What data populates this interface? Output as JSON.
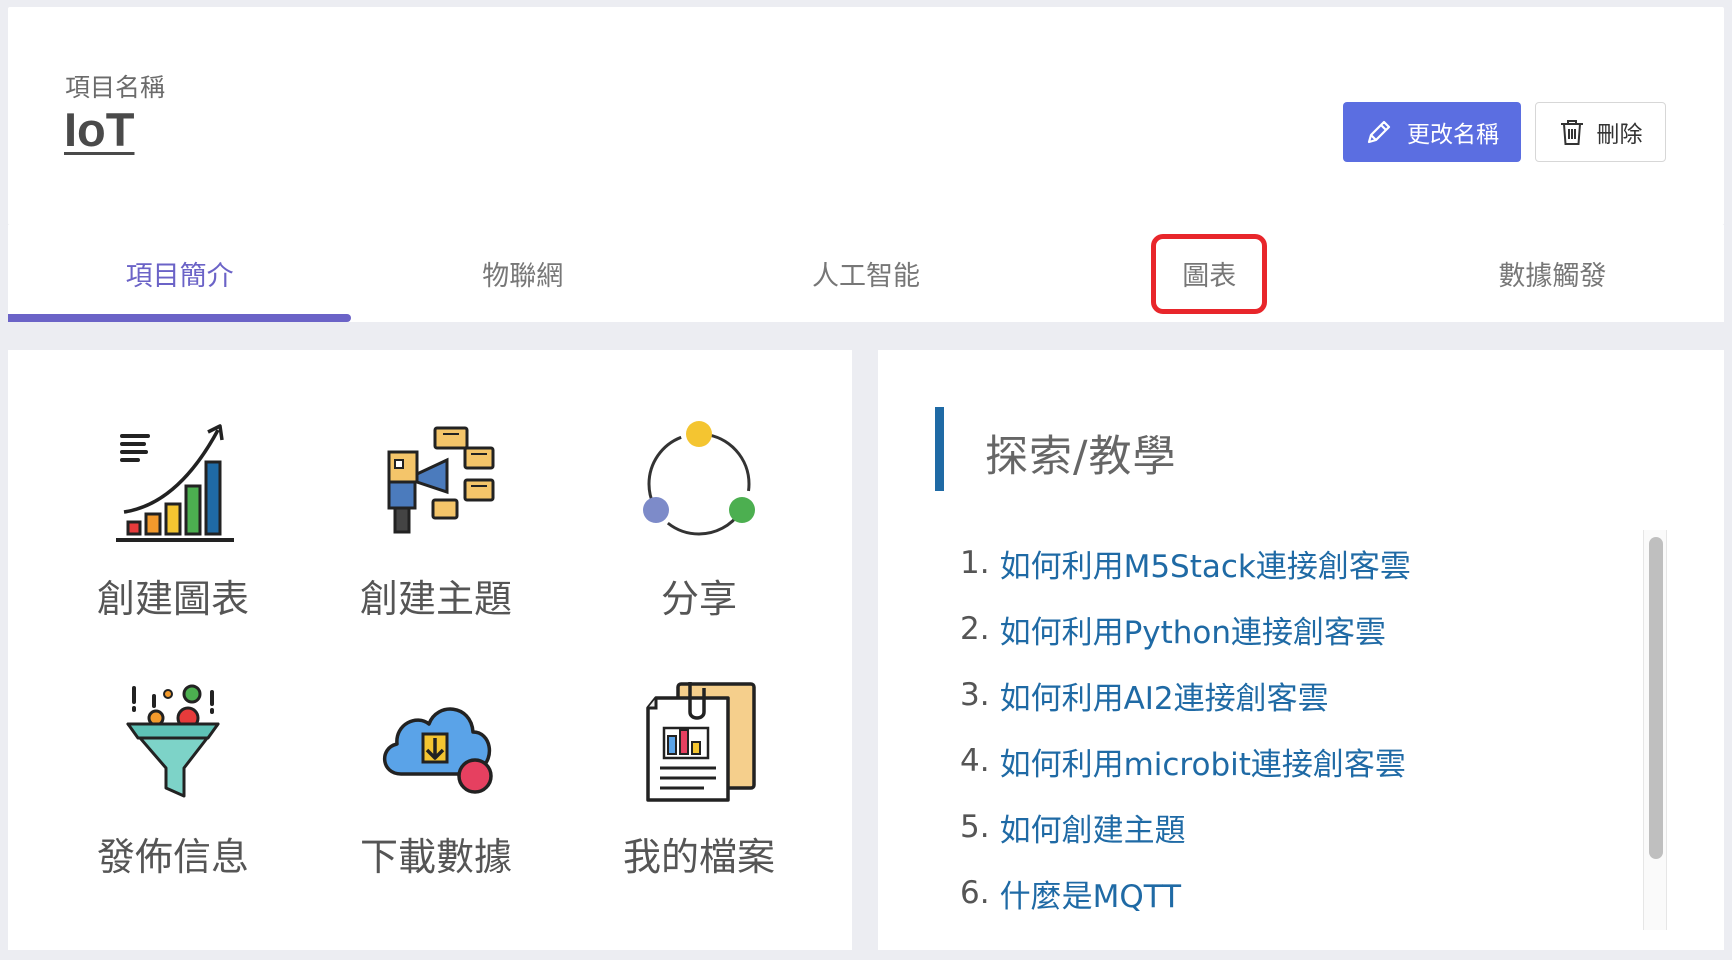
{
  "header": {
    "project_label": "項目名稱",
    "project_name": "IoT",
    "rename_label": "更改名稱",
    "delete_label": "刪除"
  },
  "tabs": [
    {
      "label": "項目簡介",
      "active": true
    },
    {
      "label": "物聯網",
      "active": false
    },
    {
      "label": "人工智能",
      "active": false
    },
    {
      "label": "圖表",
      "active": false,
      "highlighted": true
    },
    {
      "label": "數據觸發",
      "active": false
    }
  ],
  "actions": [
    {
      "label": "創建圖表",
      "icon": "growth-chart-icon"
    },
    {
      "label": "創建主題",
      "icon": "megaphone-topic-icon"
    },
    {
      "label": "分享",
      "icon": "share-cycle-icon"
    },
    {
      "label": "發佈信息",
      "icon": "funnel-icon"
    },
    {
      "label": "下載數據",
      "icon": "cloud-download-icon"
    },
    {
      "label": "我的檔案",
      "icon": "file-document-icon"
    }
  ],
  "tutorials": {
    "title": "探索/教學",
    "items": [
      {
        "num": "1.",
        "text": "如何利用M5Stack連接創客雲"
      },
      {
        "num": "2.",
        "text": "如何利用Python連接創客雲"
      },
      {
        "num": "3.",
        "text": "如何利用AI2連接創客雲"
      },
      {
        "num": "4.",
        "text": "如何利用microbit連接創客雲"
      },
      {
        "num": "5.",
        "text": "如何創建主題"
      },
      {
        "num": "6.",
        "text": "什麼是MQTT"
      }
    ]
  },
  "colors": {
    "primary": "#5b6ee1",
    "tab_active": "#6b63c7",
    "link": "#1f6aa5",
    "highlight_box": "#e8262b"
  }
}
